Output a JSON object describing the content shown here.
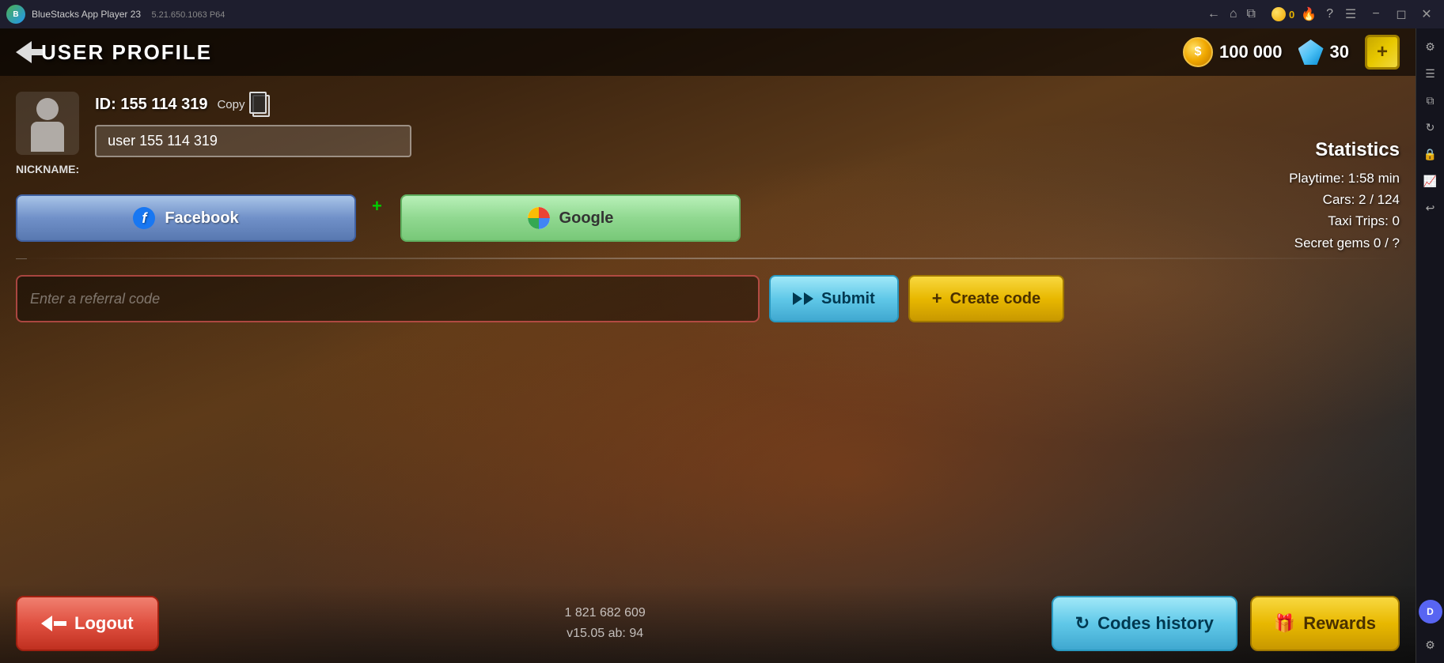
{
  "topbar": {
    "app_name": "BlueStacks App Player 23",
    "version": "5.21.650.1063  P64",
    "coin_count": "0"
  },
  "header": {
    "back_label": "",
    "title": "USER PROFILE",
    "coins": "100 000",
    "diamonds": "30",
    "add_label": "+"
  },
  "profile": {
    "id_label": "ID: 155 114 319",
    "copy_label": "Copy",
    "nickname_value": "user 155 114 319",
    "nickname_placeholder": "user 155 114 319",
    "nickname_prefix": "NICKNAME:"
  },
  "statistics": {
    "title": "Statistics",
    "playtime_label": "Playtime: 1:58 min",
    "cars_label": "Cars: 2 / 124",
    "taxi_trips_label": "Taxi Trips: 0",
    "secret_gems_label": "Secret gems 0 / ?"
  },
  "social": {
    "facebook_label": "Facebook",
    "google_label": "Google"
  },
  "referral": {
    "placeholder": "Enter a referral code",
    "submit_label": "Submit",
    "create_code_label": "Create code"
  },
  "bottom": {
    "logout_label": "Logout",
    "version_line1": "1 821 682 609",
    "version_line2": "v15.05 ab: 94",
    "codes_history_label": "Codes history",
    "rewards_label": "Rewards"
  },
  "sidebar": {
    "icons": [
      "⚙",
      "☰",
      "⊞",
      "⟳",
      "🔒",
      "📊",
      "↺"
    ]
  }
}
